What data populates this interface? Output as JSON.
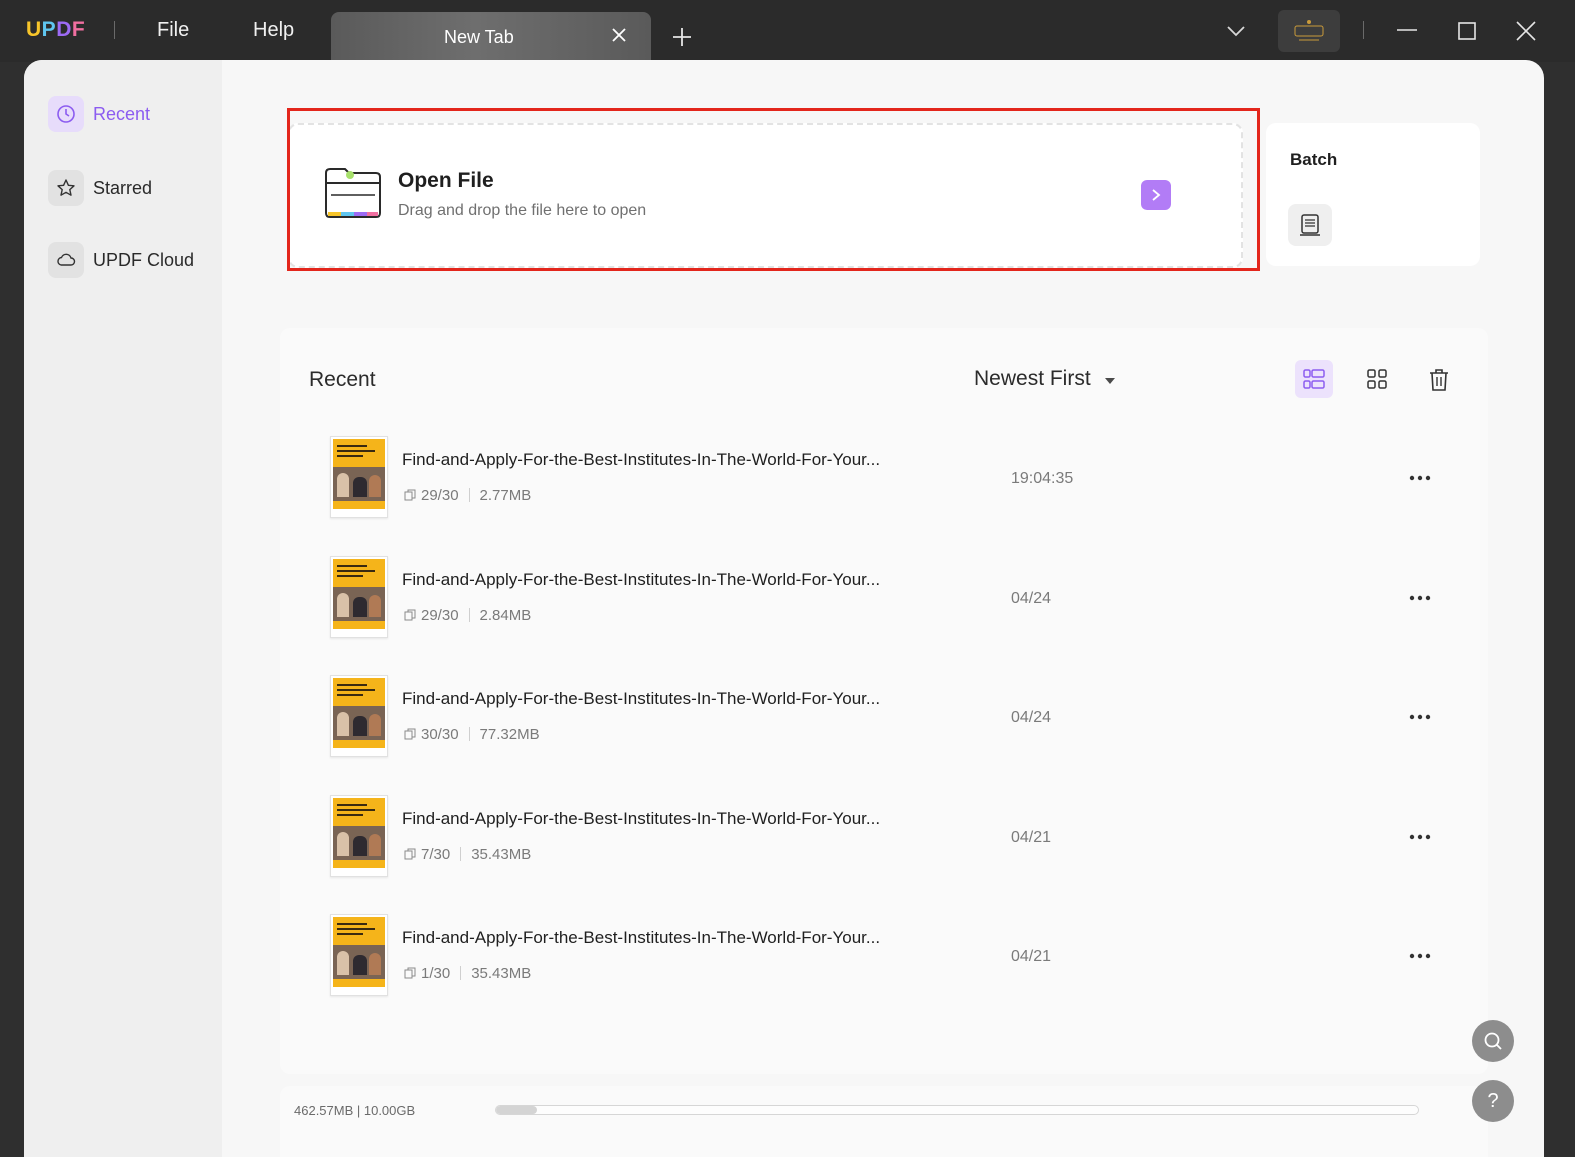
{
  "app": {
    "logo_parts": [
      "U",
      "P",
      "D",
      "F"
    ],
    "menu": {
      "file": "File",
      "help": "Help"
    },
    "tab": {
      "title": "New Tab"
    }
  },
  "sidebar": {
    "items": [
      {
        "label": "Recent",
        "icon": "clock-icon",
        "active": true
      },
      {
        "label": "Starred",
        "icon": "star-icon",
        "active": false
      },
      {
        "label": "UPDF Cloud",
        "icon": "cloud-icon",
        "active": false
      }
    ]
  },
  "open_file": {
    "title": "Open File",
    "subtitle": "Drag and drop the file here to open",
    "icon": "folder-icon",
    "arrow_icon": "chevron-right-icon"
  },
  "batch": {
    "title": "Batch",
    "icon": "batch-stack-icon"
  },
  "recent": {
    "title": "Recent",
    "sort": {
      "selected": "Newest First"
    },
    "files": [
      {
        "name": "Find-and-Apply-For-the-Best-Institutes-In-The-World-For-Your...",
        "pages": "29/30",
        "size": "2.77MB",
        "date": "19:04:35"
      },
      {
        "name": "Find-and-Apply-For-the-Best-Institutes-In-The-World-For-Your...",
        "pages": "29/30",
        "size": "2.84MB",
        "date": "04/24"
      },
      {
        "name": "Find-and-Apply-For-the-Best-Institutes-In-The-World-For-Your...",
        "pages": "30/30",
        "size": "77.32MB",
        "date": "04/24"
      },
      {
        "name": "Find-and-Apply-For-the-Best-Institutes-In-The-World-For-Your...",
        "pages": "7/30",
        "size": "35.43MB",
        "date": "04/21"
      },
      {
        "name": "Find-and-Apply-For-the-Best-Institutes-In-The-World-For-Your...",
        "pages": "1/30",
        "size": "35.43MB",
        "date": "04/21"
      }
    ]
  },
  "storage": {
    "used_label": "462.57MB | 10.00GB",
    "fraction_used": 0.045
  },
  "help": {
    "question_glyph": "?"
  },
  "colors": {
    "accent": "#8c5cf0",
    "highlight": "#e3261c",
    "titlebar": "#2b2b2b"
  }
}
